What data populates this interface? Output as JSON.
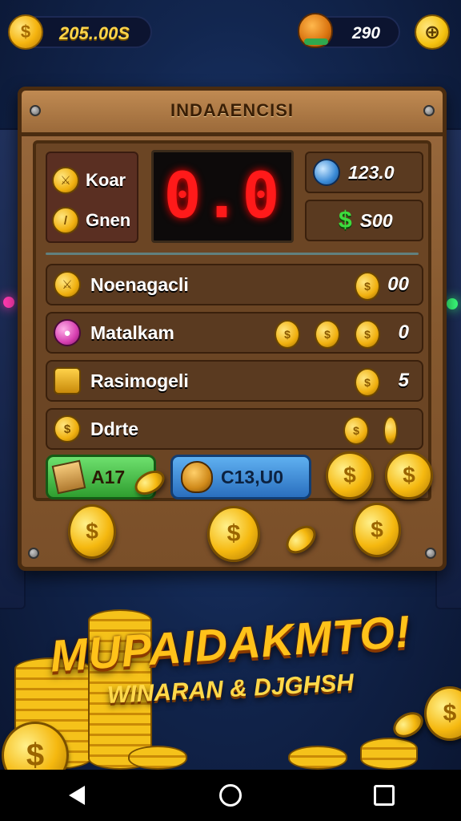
{
  "topbar": {
    "coins": "205..00S",
    "gems": "290",
    "plus_glyph": "⊕"
  },
  "board": {
    "title": "INDAAENCISI",
    "lcd": "0.0",
    "left_stats": [
      {
        "label": "Koar",
        "icon": "sword-icon"
      },
      {
        "label": "Gnen",
        "icon": "dagger-icon"
      }
    ],
    "right_stats": [
      {
        "value": "123.0",
        "icon": "blue-coin-icon"
      },
      {
        "symbol": "$",
        "value": "S00"
      }
    ],
    "rows": [
      {
        "label": "Noenagacli",
        "value": "00",
        "icon": "sword-icon"
      },
      {
        "label": "Matalkam",
        "value": "0",
        "icon": "pink-coin-icon"
      },
      {
        "label": "Rasimogeli",
        "value": "5",
        "icon": "chest-icon"
      },
      {
        "label": "Ddrte",
        "value": "",
        "icon": "coin-icon"
      }
    ],
    "buttons": {
      "green_label": "A17",
      "blue_label": "C13,U0"
    }
  },
  "promo": {
    "title": "MUPAIDAKMTO!",
    "subtitle": "WINARAN & DJGHSH"
  },
  "colors": {
    "lcd": "#ff1a1a",
    "gold": "#ffc21a",
    "dollar_green": "#3ddc3d"
  }
}
